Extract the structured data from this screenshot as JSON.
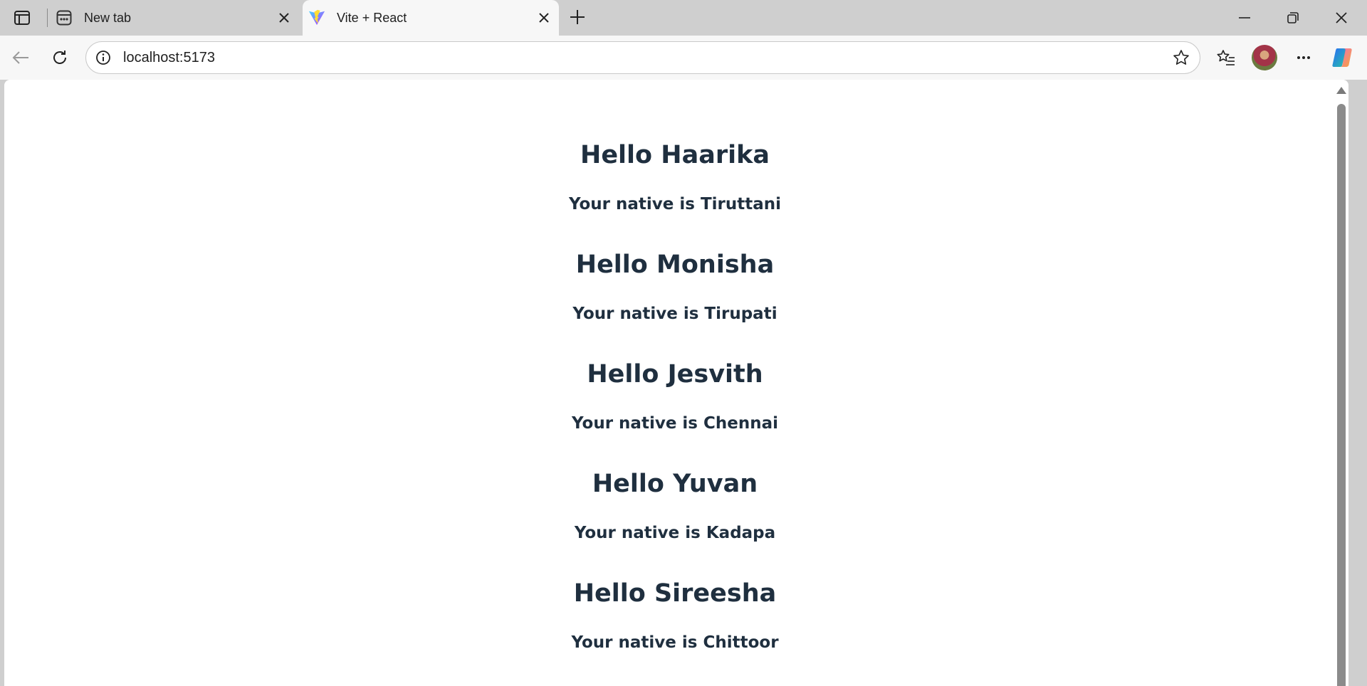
{
  "browser": {
    "tabs": [
      {
        "title": "New tab",
        "active": false,
        "icon": "new-tab-icon"
      },
      {
        "title": "Vite + React",
        "active": true,
        "icon": "vite-icon"
      }
    ],
    "address": {
      "url": "localhost:5173"
    }
  },
  "page": {
    "people": [
      {
        "greeting": "Hello Haarika",
        "native": "Your native is Tiruttani"
      },
      {
        "greeting": "Hello Monisha",
        "native": "Your native is Tirupati"
      },
      {
        "greeting": "Hello Jesvith",
        "native": "Your native is Chennai"
      },
      {
        "greeting": "Hello Yuvan",
        "native": "Your native is Kadapa"
      },
      {
        "greeting": "Hello Sireesha",
        "native": "Your native is Chittoor"
      }
    ]
  },
  "colors": {
    "heading": "#1f2f3f",
    "chrome": "#cfcfcf",
    "toolbar": "#f7f7f7"
  }
}
